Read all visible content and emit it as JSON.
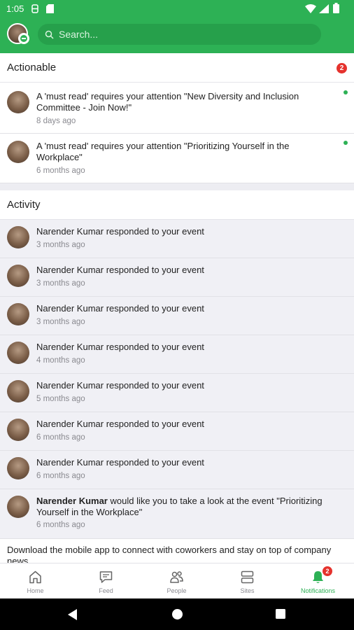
{
  "status": {
    "time": "1:05"
  },
  "search": {
    "placeholder": "Search..."
  },
  "actionable": {
    "title": "Actionable",
    "count": "2",
    "items": [
      {
        "text": "A 'must read' requires your attention \"New Diversity and Inclusion Committee - Join Now!\"",
        "time": "8 days ago"
      },
      {
        "text": "A 'must read' requires your attention \"Prioritizing Yourself in the Workplace\"",
        "time": "6 months ago"
      }
    ]
  },
  "activity": {
    "title": "Activity",
    "items": [
      {
        "text": "Narender Kumar responded to your event",
        "time": "3 months ago"
      },
      {
        "text": "Narender Kumar responded to your event",
        "time": "3 months ago"
      },
      {
        "text": "Narender Kumar responded to your event",
        "time": "3 months ago"
      },
      {
        "text": "Narender Kumar responded to your event",
        "time": "4 months ago"
      },
      {
        "text": "Narender Kumar responded to your event",
        "time": "5 months ago"
      },
      {
        "text": "Narender Kumar responded to your event",
        "time": "6 months ago"
      },
      {
        "text": "Narender Kumar responded to your event",
        "time": "6 months ago"
      },
      {
        "name": "Narender Kumar",
        "rest": " would like you to take a look at the event \"Prioritizing Yourself in the Workplace\"",
        "time": "6 months ago"
      }
    ]
  },
  "download_text": "Download the mobile app to connect with coworkers and stay on top of company news",
  "tabs": [
    {
      "label": "Home",
      "icon": "home-icon"
    },
    {
      "label": "Feed",
      "icon": "feed-icon"
    },
    {
      "label": "People",
      "icon": "people-icon"
    },
    {
      "label": "Sites",
      "icon": "sites-icon"
    },
    {
      "label": "Notifications",
      "icon": "bell-icon",
      "badge": "2"
    }
  ],
  "colors": {
    "brand": "#2db155",
    "badge": "#e5322d",
    "unread_bg": "#f0f0f5"
  }
}
